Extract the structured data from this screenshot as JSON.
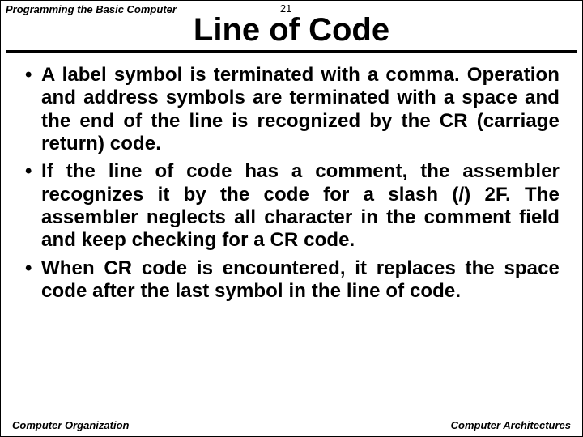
{
  "header": {
    "course": "Programming the Basic Computer",
    "slide_number": "21"
  },
  "title": "Line of Code",
  "bullets": [
    "A label symbol is terminated with a comma. Operation and address symbols are terminated with a space and the end of the line is recognized by the CR (carriage return) code.",
    "If the line of code has a comment, the assembler recognizes it by the code for a slash (/) 2F. The assembler neglects all character in the comment field and keep checking for  a CR code.",
    "When CR code is encountered, it replaces the space code after the last symbol in the line of code."
  ],
  "footer": {
    "left": "Computer Organization",
    "right": "Computer Architectures"
  }
}
